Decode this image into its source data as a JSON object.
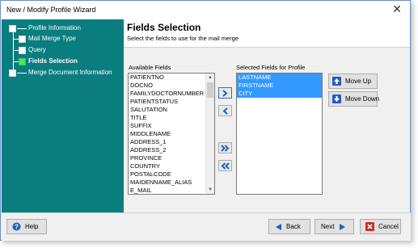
{
  "window": {
    "title": "New / Modify Profile Wizard",
    "close_glyph": "✕"
  },
  "steps": [
    {
      "label": "Profile Information",
      "active": false
    },
    {
      "label": "Mail Merge Type",
      "active": false
    },
    {
      "label": "Query",
      "active": false
    },
    {
      "label": "Fields Selection",
      "active": true
    },
    {
      "label": "Merge Document Information",
      "active": false
    }
  ],
  "page": {
    "title": "Fields Selection",
    "subtitle": "Select the fields to use for the mail merge"
  },
  "available": {
    "label": "Available Fields",
    "items": [
      "PATIENTNO",
      "DOCNO",
      "FAMILYDOCTORNUMBER",
      "PATIENTSTATUS",
      "SALUTATION",
      "TITLE",
      "SUFFIX",
      "MIDDLENAME",
      "ADDRESS_1",
      "ADDRESS_2",
      "PROVINCE",
      "COUNTRY",
      "POSTALCODE",
      "MAIDENNAME_ALIAS",
      "E_MAIL"
    ]
  },
  "selected": {
    "label": "Selected Fields for Profile",
    "items": [
      "LASTNAME",
      "FIRSTNAME",
      "CITY"
    ]
  },
  "buttons": {
    "move_up": "Move Up",
    "move_down": "Move Down",
    "help": "Help",
    "back": "Back",
    "next": "Next",
    "cancel": "Cancel"
  },
  "colors": {
    "sidebar": "#0a7d7e",
    "selection": "#3399ff",
    "arrow_blue": "#1f5fbf",
    "active_step": "#4de36a",
    "cancel_red": "#d9261c"
  }
}
